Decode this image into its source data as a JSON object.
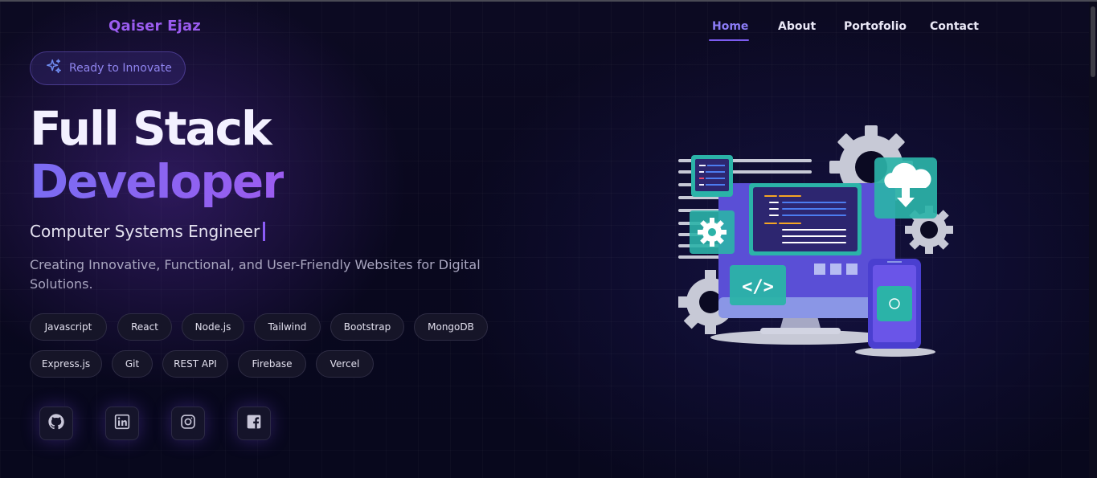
{
  "brand": {
    "logo_text": "Qaiser Ejaz"
  },
  "nav": {
    "items": [
      "Home",
      "About",
      "Portofolio",
      "Contact"
    ],
    "active": "Home"
  },
  "hero": {
    "badge": {
      "text": "Ready to Innovate",
      "icon": "sparkles-icon"
    },
    "title_line1": "Full Stack",
    "title_line2": "Developer",
    "subtitle": "Computer Systems Engineer",
    "description": "Creating Innovative, Functional, and User-Friendly Websites for Digital Solutions."
  },
  "skills": [
    "Javascript",
    "React",
    "Node.js",
    "Tailwind",
    "Bootstrap",
    "MongoDB",
    "Express.js",
    "Git",
    "REST API",
    "Firebase",
    "Vercel"
  ],
  "social": [
    {
      "icon": "github-icon"
    },
    {
      "icon": "linkedin-icon"
    },
    {
      "icon": "instagram-icon"
    },
    {
      "icon": "facebook-icon"
    }
  ],
  "colors": {
    "background": "#07061a",
    "accent": "#8b5cf6",
    "accent_blue": "#7a6cf2",
    "nav_active": "#8b7cf6",
    "chip_bg": "#161528",
    "illustration_teal": "#2bb3a8",
    "illustration_purple": "#6a55e8"
  }
}
